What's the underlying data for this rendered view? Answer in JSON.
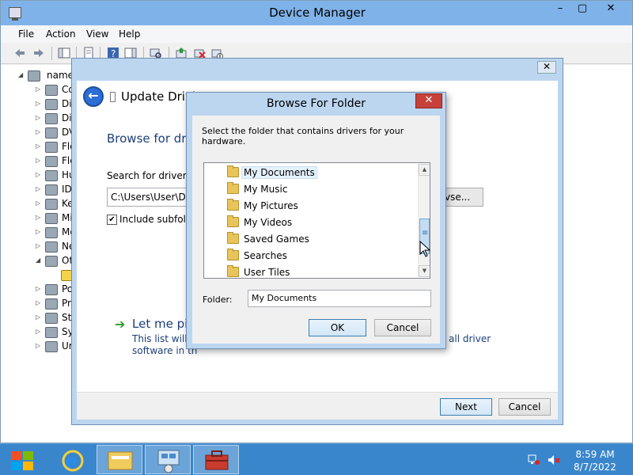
{
  "device_manager": {
    "title": "Device Manager",
    "menu": [
      "File",
      "Action",
      "View",
      "Help"
    ],
    "tree_root": "name",
    "tree_items": [
      "Co",
      "Dis",
      "Dis",
      "DV",
      "Flo",
      "Flo",
      "Hu",
      "IDI",
      "Ke",
      "Mi",
      "Mo",
      "Ne",
      "Ot",
      "",
      "Po",
      "Pro",
      "Sto",
      "Sy",
      "Ur"
    ]
  },
  "update_driver": {
    "title": "Update Drivi",
    "heading": "Browse for driv",
    "search_label": "Search for driver so",
    "path_value": "C:\\Users\\User\\Doc",
    "browse_label": "vse...",
    "include_subfolders_label": "Include subfolde",
    "include_subfolders_checked": true,
    "let_me_pick": "Let me pic",
    "desc_line1": "This list will s",
    "desc_line2": "software in th",
    "desc_right": "all driver",
    "next_label": "Next",
    "cancel_label": "Cancel"
  },
  "browse_folder": {
    "title": "Browse For Folder",
    "instruction": "Select the folder that contains drivers for your hardware.",
    "folders": [
      {
        "label": "My Documents",
        "selected": true
      },
      {
        "label": "My Music",
        "selected": false
      },
      {
        "label": "My Pictures",
        "selected": false
      },
      {
        "label": "My Videos",
        "selected": false
      },
      {
        "label": "Saved Games",
        "selected": false
      },
      {
        "label": "Searches",
        "selected": false
      },
      {
        "label": "User Tiles",
        "selected": false
      }
    ],
    "folder_label": "Folder:",
    "folder_value": "My Documents",
    "ok_label": "OK",
    "cancel_label": "Cancel"
  },
  "taskbar": {
    "time": "8:59 AM",
    "date": "8/7/2022"
  },
  "colors": {
    "titlebar": "#7fb2e8",
    "taskbar": "#3a86cc",
    "close_red": "#c7413a",
    "heading_blue": "#1c3f7a"
  }
}
